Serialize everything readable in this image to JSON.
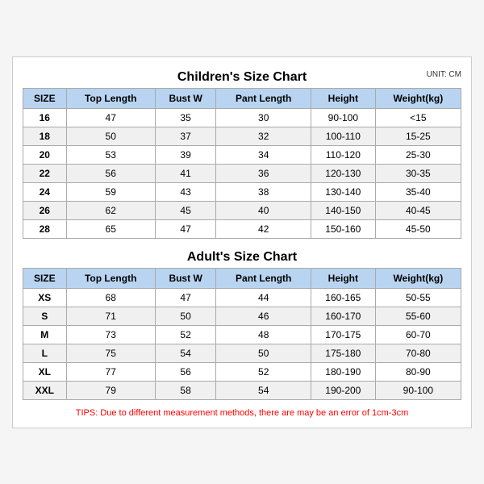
{
  "children_title": "Children's Size Chart",
  "adults_title": "Adult's Size Chart",
  "unit_label": "UNIT: CM",
  "headers": [
    "SIZE",
    "Top Length",
    "Bust W",
    "Pant Length",
    "Height",
    "Weight(kg)"
  ],
  "children_rows": [
    [
      "16",
      "47",
      "35",
      "30",
      "90-100",
      "<15"
    ],
    [
      "18",
      "50",
      "37",
      "32",
      "100-110",
      "15-25"
    ],
    [
      "20",
      "53",
      "39",
      "34",
      "110-120",
      "25-30"
    ],
    [
      "22",
      "56",
      "41",
      "36",
      "120-130",
      "30-35"
    ],
    [
      "24",
      "59",
      "43",
      "38",
      "130-140",
      "35-40"
    ],
    [
      "26",
      "62",
      "45",
      "40",
      "140-150",
      "40-45"
    ],
    [
      "28",
      "65",
      "47",
      "42",
      "150-160",
      "45-50"
    ]
  ],
  "adult_rows": [
    [
      "XS",
      "68",
      "47",
      "44",
      "160-165",
      "50-55"
    ],
    [
      "S",
      "71",
      "50",
      "46",
      "160-170",
      "55-60"
    ],
    [
      "M",
      "73",
      "52",
      "48",
      "170-175",
      "60-70"
    ],
    [
      "L",
      "75",
      "54",
      "50",
      "175-180",
      "70-80"
    ],
    [
      "XL",
      "77",
      "56",
      "52",
      "180-190",
      "80-90"
    ],
    [
      "XXL",
      "79",
      "58",
      "54",
      "190-200",
      "90-100"
    ]
  ],
  "tips": "TIPS: Due to different measurement methods, there are may be an error of 1cm-3cm"
}
